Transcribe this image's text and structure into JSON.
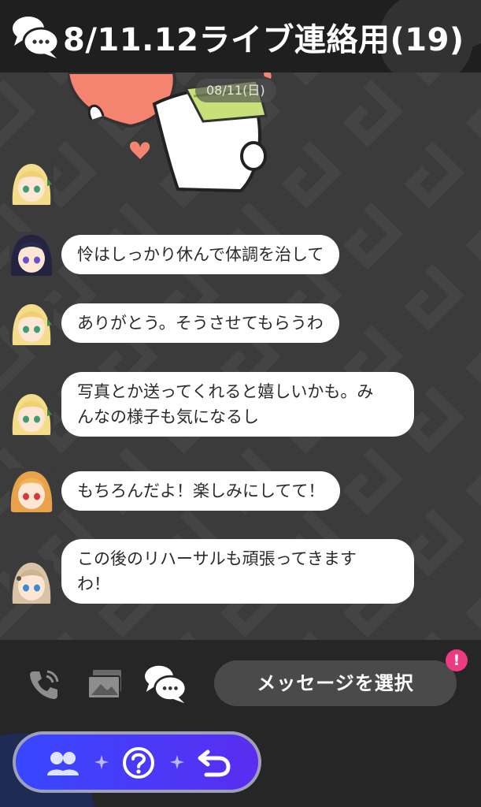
{
  "header": {
    "title": "8/11.12ライブ連絡用(19)",
    "icon": "chat-bubbles-icon"
  },
  "chat": {
    "date_label": "08/11(日)",
    "messages": [
      {
        "avatar": "blonde-green-eyes",
        "text_lines": [
          "怜はしっかり休んで体調を治して"
        ],
        "sender_avatar": "dark-hair-purple-eyes"
      },
      {
        "avatar": "blonde-green-eyes",
        "text_lines": [
          "ありがとう。そうさせてもらうわ"
        ]
      },
      {
        "avatar": "blonde-green-eyes",
        "text_lines": [
          "写真とか送ってくれると嬉しいかも。み",
          "んなの様子も気になるし"
        ]
      },
      {
        "avatar": "orange-hair-red-eyes",
        "text_lines": [
          "もちろんだよ！楽しみにしてて！"
        ]
      },
      {
        "avatar": "light-brown-blue-eyes",
        "text_lines": [
          "この後のリハーサルも頑張ってきます",
          "わ！"
        ]
      }
    ]
  },
  "toolbar": {
    "call_icon": "phone-icon",
    "photo_icon": "photo-icon",
    "chat_icon": "chat-bubbles-icon",
    "select_label": "メッセージを選択",
    "badge": "!"
  },
  "nav": {
    "items": [
      "members-icon",
      "help-icon",
      "back-icon"
    ]
  },
  "colors": {
    "accent": "#3848ff",
    "badge": "#ec3b82",
    "bubble": "#ffffff",
    "chat_bg": "#3b3b3b"
  }
}
